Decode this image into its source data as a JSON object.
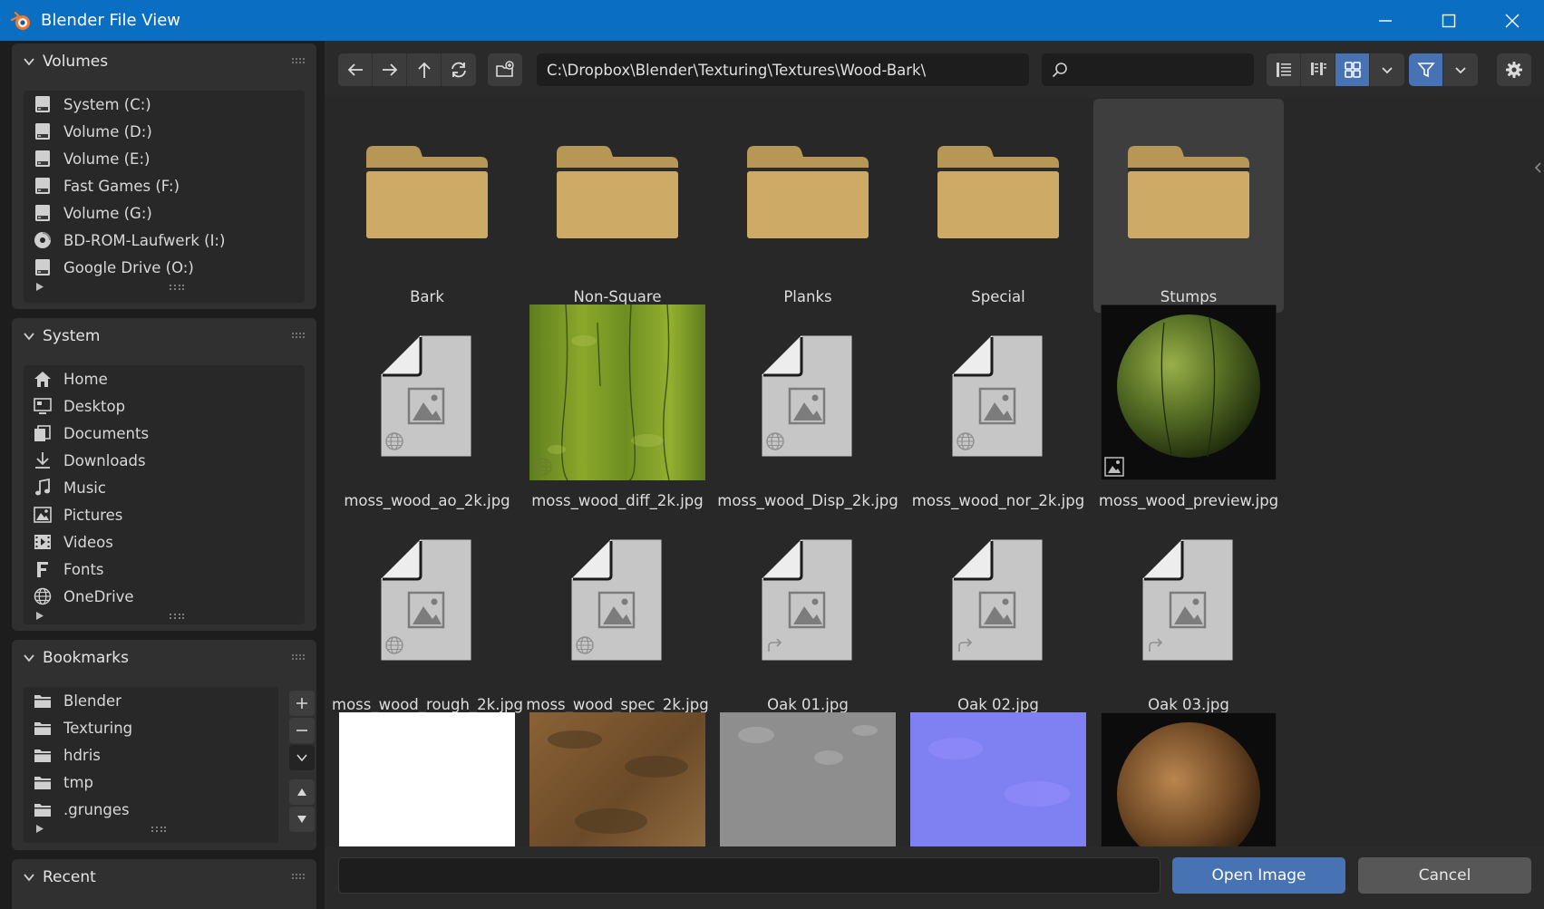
{
  "window": {
    "title": "Blender File View",
    "controls": [
      "minimize-icon",
      "maximize-icon",
      "close-icon"
    ]
  },
  "sidebar": {
    "volumes": {
      "title": "Volumes",
      "items": [
        {
          "label": "System (C:)",
          "icon": "drive-icon"
        },
        {
          "label": "Volume (D:)",
          "icon": "drive-icon"
        },
        {
          "label": "Volume (E:)",
          "icon": "drive-icon"
        },
        {
          "label": "Fast Games (F:)",
          "icon": "drive-icon"
        },
        {
          "label": "Volume (G:)",
          "icon": "drive-icon"
        },
        {
          "label": "BD-ROM-Laufwerk (I:)",
          "icon": "disc-icon"
        },
        {
          "label": "Google Drive (O:)",
          "icon": "drive-icon"
        }
      ]
    },
    "system": {
      "title": "System",
      "items": [
        {
          "label": "Home",
          "icon": "home-icon"
        },
        {
          "label": "Desktop",
          "icon": "desktop-icon"
        },
        {
          "label": "Documents",
          "icon": "documents-icon"
        },
        {
          "label": "Downloads",
          "icon": "download-icon"
        },
        {
          "label": "Music",
          "icon": "music-icon"
        },
        {
          "label": "Pictures",
          "icon": "picture-icon"
        },
        {
          "label": "Videos",
          "icon": "video-icon"
        },
        {
          "label": "Fonts",
          "icon": "font-icon"
        },
        {
          "label": "OneDrive",
          "icon": "globe-icon"
        }
      ]
    },
    "bookmarks": {
      "title": "Bookmarks",
      "items": [
        {
          "label": "Blender",
          "icon": "folder-icon"
        },
        {
          "label": "Texturing",
          "icon": "folder-icon"
        },
        {
          "label": "hdris",
          "icon": "folder-icon"
        },
        {
          "label": "tmp",
          "icon": "folder-icon"
        },
        {
          "label": ".grunges",
          "icon": "folder-icon"
        }
      ]
    },
    "recent": {
      "title": "Recent"
    }
  },
  "toolbar": {
    "path": "C:\\Dropbox\\Blender\\Texturing\\Textures\\Wood-Bark\\",
    "search_placeholder": "",
    "display_mode": "thumbnails",
    "filter_enabled": true
  },
  "files": [
    {
      "name": "Bark",
      "kind": "folder"
    },
    {
      "name": "Non-Square",
      "kind": "folder"
    },
    {
      "name": "Planks",
      "kind": "folder"
    },
    {
      "name": "Special",
      "kind": "folder"
    },
    {
      "name": "Stumps",
      "kind": "folder",
      "selected": true
    },
    {
      "name": "moss_wood_ao_2k.jpg",
      "kind": "image-generic",
      "badge": "globe"
    },
    {
      "name": "moss_wood_diff_2k.jpg",
      "kind": "image-moss",
      "badge": "globe"
    },
    {
      "name": "moss_wood_Disp_2k.jpg",
      "kind": "image-generic",
      "badge": "globe"
    },
    {
      "name": "moss_wood_nor_2k.jpg",
      "kind": "image-generic",
      "badge": "globe"
    },
    {
      "name": "moss_wood_preview.jpg",
      "kind": "image-sphere",
      "badge": "image"
    },
    {
      "name": "moss_wood_rough_2k.jpg",
      "kind": "image-generic",
      "badge": "globe"
    },
    {
      "name": "moss_wood_spec_2k.jpg",
      "kind": "image-generic",
      "badge": "globe"
    },
    {
      "name": "Oak 01.jpg",
      "kind": "image-generic",
      "badge": "link"
    },
    {
      "name": "Oak 02.jpg",
      "kind": "image-generic",
      "badge": "link"
    },
    {
      "name": "Oak 03.jpg",
      "kind": "image-generic",
      "badge": "link"
    },
    {
      "name": "",
      "kind": "image-white"
    },
    {
      "name": "",
      "kind": "image-bark"
    },
    {
      "name": "",
      "kind": "image-gray"
    },
    {
      "name": "",
      "kind": "image-normal"
    },
    {
      "name": "",
      "kind": "image-sphere-brown"
    }
  ],
  "bottom": {
    "filename_value": "",
    "open_label": "Open Image",
    "cancel_label": "Cancel"
  },
  "colors": {
    "titlebar": "#0a6fc2",
    "accent": "#4772b3",
    "folder": "#cdaa66"
  }
}
